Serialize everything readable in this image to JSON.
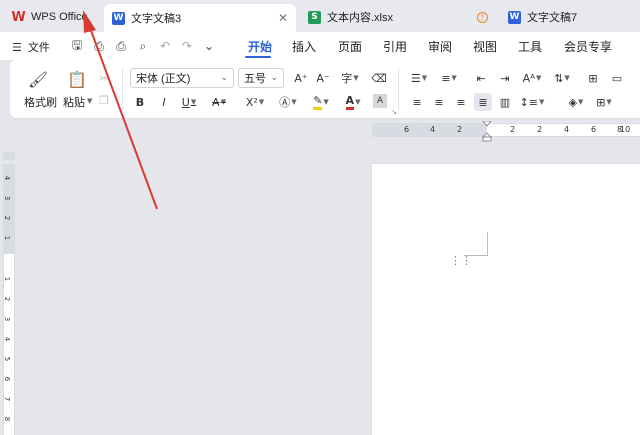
{
  "tabs": {
    "home": {
      "label": "WPS Office"
    },
    "doc3": {
      "label": "文字文稿3",
      "close": "✕"
    },
    "xlsx": {
      "label": "文本内容.xlsx",
      "warn": "!"
    },
    "doc7": {
      "label": "文字文稿7"
    }
  },
  "menu": {
    "file": "文件",
    "tabs": [
      "开始",
      "插入",
      "页面",
      "引用",
      "审阅",
      "视图",
      "工具",
      "会员专享"
    ],
    "active_tab": "开始"
  },
  "ribbon": {
    "format_painter": "格式刷",
    "paste": "粘贴",
    "font_name": "宋体 (正文)",
    "font_size": "五号",
    "bold": "B",
    "italic": "I",
    "underline": "U",
    "strike": "A",
    "superscript": "X²",
    "shading": "A"
  },
  "ruler": {
    "h_numbers": [
      "6",
      "4",
      "2",
      "2",
      "2",
      "4",
      "6",
      "8",
      "10"
    ],
    "v_numbers": [
      "4",
      "3",
      "2",
      "1",
      "1",
      "2",
      "3",
      "4",
      "5",
      "6",
      "7",
      "8"
    ]
  },
  "colors": {
    "accent": "#2d63d6",
    "wps_red": "#d0312d",
    "excel_green": "#1f9d55",
    "annotation_arrow": "#d63a33"
  }
}
